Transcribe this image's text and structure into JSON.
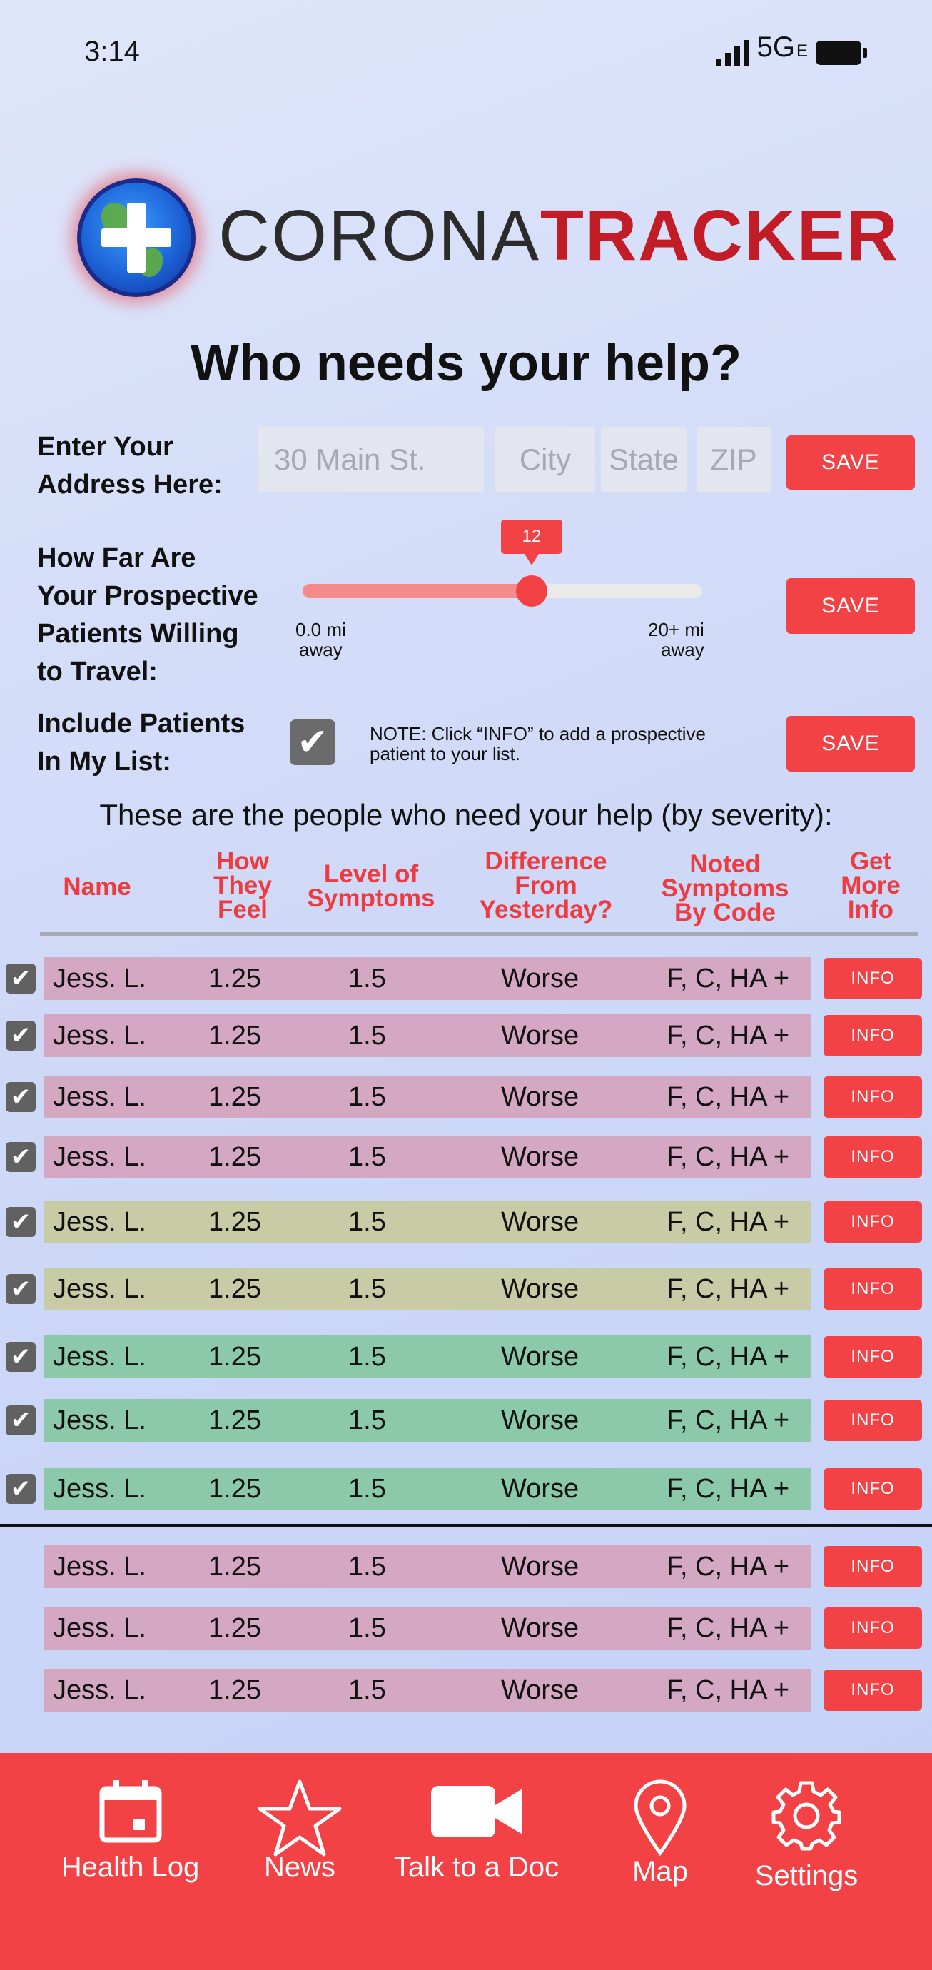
{
  "status": {
    "time": "3:14",
    "network": "5G",
    "network_sub": "E"
  },
  "logo": {
    "word1": "CORONA",
    "word2": "TRACKER"
  },
  "headline": "Who needs your help?",
  "address": {
    "label": "Enter Your\nAddress Here:",
    "street_placeholder": "30 Main St.",
    "city_placeholder": "City",
    "state_placeholder": "State",
    "zip_placeholder": "ZIP",
    "save": "SAVE"
  },
  "distance": {
    "label": "How Far Are\nYour Prospective\nPatients Willing\nto Travel:",
    "value": 12,
    "value_label": "12",
    "min_label": "0.0 mi\naway",
    "max_label": "20+ mi\naway",
    "save": "SAVE"
  },
  "include": {
    "label": "Include Patients\nIn My List:",
    "checked": true,
    "note": "NOTE: Click “INFO” to add a prospective patient to your list.",
    "save": "SAVE"
  },
  "list_title": "These are the people who need your help (by severity):",
  "columns": {
    "name": "Name",
    "feel": "How\nThey\nFeel",
    "level": "Level of\nSymptoms",
    "diff": "Difference\nFrom\nYesterday?",
    "noted": "Noted\nSymptoms\nBy Code",
    "info": "Get\nMore\nInfo"
  },
  "colors": {
    "accent": "#f24246",
    "severe": "#d4a7c2",
    "moderate": "#c8cca6",
    "mild": "#8cc9ab"
  },
  "rows": [
    {
      "name": "Jess. L.",
      "feel": "1.25",
      "level": "1.5",
      "diff": "Worse",
      "code": "F, C, HA +",
      "info": "INFO",
      "checked": true,
      "severity": "severe"
    },
    {
      "name": "Jess. L.",
      "feel": "1.25",
      "level": "1.5",
      "diff": "Worse",
      "code": "F, C, HA +",
      "info": "INFO",
      "checked": true,
      "severity": "severe"
    },
    {
      "name": "Jess. L.",
      "feel": "1.25",
      "level": "1.5",
      "diff": "Worse",
      "code": "F, C, HA +",
      "info": "INFO",
      "checked": true,
      "severity": "severe"
    },
    {
      "name": "Jess. L.",
      "feel": "1.25",
      "level": "1.5",
      "diff": "Worse",
      "code": "F, C, HA +",
      "info": "INFO",
      "checked": true,
      "severity": "severe"
    },
    {
      "name": "Jess. L.",
      "feel": "1.25",
      "level": "1.5",
      "diff": "Worse",
      "code": "F, C, HA +",
      "info": "INFO",
      "checked": true,
      "severity": "moderate"
    },
    {
      "name": "Jess. L.",
      "feel": "1.25",
      "level": "1.5",
      "diff": "Worse",
      "code": "F, C, HA +",
      "info": "INFO",
      "checked": true,
      "severity": "moderate"
    },
    {
      "name": "Jess. L.",
      "feel": "1.25",
      "level": "1.5",
      "diff": "Worse",
      "code": "F, C, HA +",
      "info": "INFO",
      "checked": true,
      "severity": "mild"
    },
    {
      "name": "Jess. L.",
      "feel": "1.25",
      "level": "1.5",
      "diff": "Worse",
      "code": "F, C, HA +",
      "info": "INFO",
      "checked": true,
      "severity": "mild"
    },
    {
      "name": "Jess. L.",
      "feel": "1.25",
      "level": "1.5",
      "diff": "Worse",
      "code": "F, C, HA +",
      "info": "INFO",
      "checked": true,
      "severity": "mild"
    },
    {
      "name": "Jess. L.",
      "feel": "1.25",
      "level": "1.5",
      "diff": "Worse",
      "code": "F, C, HA +",
      "info": "INFO",
      "checked": false,
      "severity": "severe"
    },
    {
      "name": "Jess. L.",
      "feel": "1.25",
      "level": "1.5",
      "diff": "Worse",
      "code": "F, C, HA +",
      "info": "INFO",
      "checked": false,
      "severity": "severe"
    },
    {
      "name": "Jess. L.",
      "feel": "1.25",
      "level": "1.5",
      "diff": "Worse",
      "code": "F, C, HA +",
      "info": "INFO",
      "checked": false,
      "severity": "severe"
    }
  ],
  "nav": [
    {
      "label": "Health Log",
      "icon": "calendar-icon"
    },
    {
      "label": "News",
      "icon": "star-icon"
    },
    {
      "label": "Talk to a Doc",
      "icon": "video-camera-icon"
    },
    {
      "label": "Map",
      "icon": "map-pin-icon"
    },
    {
      "label": "Settings",
      "icon": "gear-icon"
    }
  ]
}
